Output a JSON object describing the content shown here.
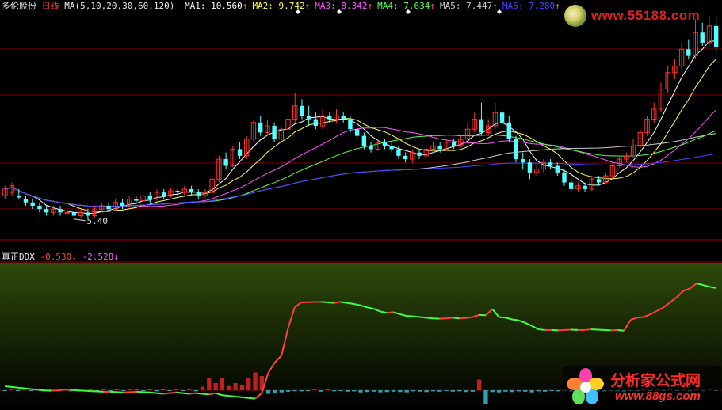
{
  "header": {
    "stock_name": "多伦股份",
    "period": "日线",
    "ma_spec": "MA(5,10,20,30,60,120)",
    "ma_values": [
      {
        "label": "MA1:",
        "value": "10.560",
        "arrow": "↑",
        "color": "#ffffff"
      },
      {
        "label": "MA2:",
        "value": "9.742",
        "arrow": "↑",
        "color": "#ffff55"
      },
      {
        "label": "MA3:",
        "value": "8.342",
        "arrow": "↑",
        "color": "#ff55ff"
      },
      {
        "label": "MA4:",
        "value": "7.634",
        "arrow": "↑",
        "color": "#55ff55"
      },
      {
        "label": "MA5:",
        "value": "7.447",
        "arrow": "↑",
        "color": "#cccccc"
      },
      {
        "label": "MA6:",
        "value": "7.280",
        "arrow": "↑",
        "color": "#4444ff"
      }
    ]
  },
  "ddx_header": {
    "name": "真正DDX",
    "value1": "-0.530",
    "arrow1": "↓",
    "value2": "-2.528",
    "arrow2": "↓"
  },
  "low_label": "5.40",
  "watermark_top": {
    "url": "www.55188.com"
  },
  "watermark_bottom": {
    "title": "分析家公式网",
    "url": "www.88gs.com"
  },
  "colors": {
    "up": "#ff3232",
    "down": "#54ffff",
    "ma1": "#ffffff",
    "ma2": "#ffff55",
    "ma3": "#ff55ff",
    "ma4": "#55ff55",
    "ma5": "#cccccc",
    "ma6": "#4444ff",
    "grid": "#800000",
    "ddx_up": "#ff4040",
    "ddx_down": "#40ff40"
  },
  "chart_data": [
    {
      "type": "candlestick",
      "title": "多伦股份 日线",
      "ylim": [
        4.8,
        11.6
      ],
      "lowest_marked": 5.4,
      "candles": [
        [
          6.1,
          6.3,
          6.4,
          6.0
        ],
        [
          6.2,
          6.4,
          6.5,
          6.1
        ],
        [
          6.1,
          6.05,
          6.3,
          6.0
        ],
        [
          6.0,
          5.9,
          6.1,
          5.8
        ],
        [
          5.9,
          5.8,
          6.0,
          5.7
        ],
        [
          5.8,
          5.7,
          5.9,
          5.6
        ],
        [
          5.7,
          5.6,
          5.8,
          5.5
        ],
        [
          5.6,
          5.7,
          5.8,
          5.5
        ],
        [
          5.7,
          5.6,
          5.8,
          5.5
        ],
        [
          5.6,
          5.6,
          5.7,
          5.5
        ],
        [
          5.6,
          5.5,
          5.7,
          5.4
        ],
        [
          5.5,
          5.6,
          5.7,
          5.45
        ],
        [
          5.6,
          5.5,
          5.7,
          5.4
        ],
        [
          5.5,
          5.7,
          5.8,
          5.45
        ],
        [
          5.7,
          5.8,
          5.9,
          5.6
        ],
        [
          5.8,
          5.7,
          5.9,
          5.65
        ],
        [
          5.7,
          5.9,
          6.0,
          5.65
        ],
        [
          5.9,
          5.8,
          6.0,
          5.7
        ],
        [
          5.8,
          6.0,
          6.1,
          5.75
        ],
        [
          6.0,
          5.95,
          6.1,
          5.85
        ],
        [
          5.95,
          6.1,
          6.2,
          5.9
        ],
        [
          6.1,
          6.0,
          6.2,
          5.9
        ],
        [
          6.0,
          6.2,
          6.3,
          5.95
        ],
        [
          6.2,
          6.1,
          6.3,
          6.0
        ],
        [
          6.1,
          6.25,
          6.35,
          6.05
        ],
        [
          6.25,
          6.2,
          6.3,
          6.1
        ],
        [
          6.2,
          6.3,
          6.4,
          6.1
        ],
        [
          6.3,
          6.2,
          6.4,
          6.1
        ],
        [
          6.2,
          6.1,
          6.3,
          6.0
        ],
        [
          6.1,
          6.2,
          6.3,
          6.05
        ],
        [
          6.2,
          6.6,
          6.7,
          6.15
        ],
        [
          6.6,
          7.2,
          7.3,
          6.5
        ],
        [
          7.2,
          7.0,
          7.4,
          6.9
        ],
        [
          7.0,
          7.5,
          7.6,
          6.95
        ],
        [
          7.5,
          7.3,
          7.7,
          7.2
        ],
        [
          7.3,
          7.8,
          7.9,
          7.2
        ],
        [
          7.8,
          8.3,
          8.4,
          7.7
        ],
        [
          8.3,
          8.0,
          8.5,
          7.9
        ],
        [
          8.0,
          8.2,
          8.4,
          7.9
        ],
        [
          8.2,
          7.8,
          8.3,
          7.7
        ],
        [
          7.8,
          8.1,
          8.2,
          7.7
        ],
        [
          8.1,
          8.4,
          8.6,
          8.0
        ],
        [
          8.4,
          8.8,
          9.2,
          8.3
        ],
        [
          8.8,
          8.5,
          9.0,
          8.4
        ],
        [
          8.5,
          8.4,
          8.8,
          8.2
        ],
        [
          8.4,
          8.2,
          8.6,
          8.1
        ],
        [
          8.2,
          8.5,
          8.7,
          8.1
        ],
        [
          8.5,
          8.4,
          8.6,
          8.3
        ],
        [
          8.4,
          8.5,
          8.7,
          8.3
        ],
        [
          8.5,
          8.4,
          8.6,
          8.3
        ],
        [
          8.4,
          8.1,
          8.5,
          8.0
        ],
        [
          8.1,
          7.9,
          8.2,
          7.8
        ],
        [
          7.9,
          7.6,
          8.0,
          7.5
        ],
        [
          7.6,
          7.5,
          7.7,
          7.4
        ],
        [
          7.5,
          7.7,
          7.8,
          7.45
        ],
        [
          7.7,
          7.6,
          7.8,
          7.5
        ],
        [
          7.6,
          7.5,
          7.7,
          7.4
        ],
        [
          7.5,
          7.3,
          7.6,
          7.2
        ],
        [
          7.3,
          7.2,
          7.4,
          7.1
        ],
        [
          7.2,
          7.4,
          7.5,
          7.1
        ],
        [
          7.4,
          7.3,
          7.5,
          7.2
        ],
        [
          7.3,
          7.5,
          7.6,
          7.25
        ],
        [
          7.5,
          7.6,
          7.7,
          7.4
        ],
        [
          7.6,
          7.5,
          7.7,
          7.4
        ],
        [
          7.5,
          7.7,
          7.8,
          7.45
        ],
        [
          7.7,
          7.6,
          7.8,
          7.5
        ],
        [
          7.6,
          7.8,
          7.9,
          7.55
        ],
        [
          7.8,
          8.1,
          8.3,
          7.75
        ],
        [
          8.1,
          8.4,
          8.6,
          8.0
        ],
        [
          8.4,
          8.0,
          8.9,
          7.9
        ],
        [
          8.0,
          8.2,
          8.4,
          7.9
        ],
        [
          8.2,
          8.6,
          8.9,
          8.1
        ],
        [
          8.6,
          8.3,
          8.7,
          8.2
        ],
        [
          8.3,
          7.8,
          8.5,
          7.7
        ],
        [
          7.8,
          7.2,
          7.9,
          7.1
        ],
        [
          7.2,
          7.1,
          7.4,
          6.9
        ],
        [
          7.1,
          6.8,
          7.2,
          6.6
        ],
        [
          6.8,
          6.9,
          7.0,
          6.7
        ],
        [
          6.9,
          7.1,
          7.2,
          6.8
        ],
        [
          7.1,
          7.0,
          7.2,
          6.9
        ],
        [
          7.0,
          6.8,
          7.1,
          6.7
        ],
        [
          6.8,
          6.5,
          6.9,
          6.4
        ],
        [
          6.5,
          6.3,
          6.6,
          6.2
        ],
        [
          6.3,
          6.4,
          6.5,
          6.2
        ],
        [
          6.4,
          6.3,
          6.5,
          6.2
        ],
        [
          6.3,
          6.6,
          6.7,
          6.25
        ],
        [
          6.6,
          6.5,
          6.7,
          6.4
        ],
        [
          6.5,
          6.7,
          6.8,
          6.45
        ],
        [
          6.7,
          7.0,
          7.1,
          6.65
        ],
        [
          7.0,
          7.2,
          7.3,
          6.95
        ],
        [
          7.2,
          7.3,
          7.4,
          7.1
        ],
        [
          7.3,
          7.6,
          7.8,
          7.25
        ],
        [
          7.6,
          8.0,
          8.1,
          7.55
        ],
        [
          8.0,
          8.4,
          8.5,
          7.9
        ],
        [
          8.4,
          8.7,
          8.9,
          8.3
        ],
        [
          8.7,
          9.3,
          9.5,
          8.6
        ],
        [
          9.3,
          9.8,
          10.0,
          9.2
        ],
        [
          9.8,
          10.0,
          10.2,
          9.6
        ],
        [
          10.0,
          10.5,
          10.7,
          9.9
        ],
        [
          10.5,
          10.3,
          10.8,
          10.2
        ],
        [
          10.3,
          11.0,
          11.4,
          10.2
        ],
        [
          11.0,
          10.7,
          11.3,
          10.6
        ],
        [
          10.7,
          11.2,
          11.5,
          10.6
        ],
        [
          11.2,
          10.56,
          11.5,
          10.4
        ]
      ],
      "moving_averages": [
        "MA1",
        "MA2",
        "MA3",
        "MA4",
        "MA5",
        "MA6"
      ]
    },
    {
      "type": "line",
      "title": "真正DDX",
      "ylim": [
        -3.0,
        1.2
      ],
      "series": [
        {
          "name": "DDX",
          "values": [
            -2.4,
            -2.42,
            -2.44,
            -2.46,
            -2.48,
            -2.5,
            -2.52,
            -2.53,
            -2.52,
            -2.5,
            -2.5,
            -2.52,
            -2.53,
            -2.54,
            -2.55,
            -2.56,
            -2.56,
            -2.57,
            -2.58,
            -2.57,
            -2.56,
            -2.57,
            -2.58,
            -2.6,
            -2.62,
            -2.6,
            -2.58,
            -2.6,
            -2.62,
            -2.6,
            -2.62,
            -2.64,
            -2.6,
            -2.66,
            -2.68,
            -2.7,
            -2.72,
            -2.74,
            -2.76,
            -2.6,
            -2.0,
            -1.7,
            -1.5,
            -0.7,
            -0.1,
            0.05,
            0.05,
            0.06,
            0.06,
            0.05,
            0.03,
            0.06,
            0.03,
            0.0,
            -0.04,
            -0.1,
            -0.14,
            -0.22,
            -0.26,
            -0.24,
            -0.3,
            -0.35,
            -0.36,
            -0.38,
            -0.4,
            -0.42,
            -0.43,
            -0.42,
            -0.4,
            -0.42,
            -0.41,
            -0.38,
            -0.32,
            -0.33,
            -0.15,
            -0.38,
            -0.4,
            -0.45,
            -0.48,
            -0.55,
            -0.64,
            -0.74,
            -0.76,
            -0.76,
            -0.77,
            -0.76,
            -0.75,
            -0.76,
            -0.76,
            -0.74,
            -0.75,
            -0.76,
            -0.77,
            -0.76,
            -0.78,
            -0.46,
            -0.4,
            -0.38,
            -0.3,
            -0.2,
            -0.1,
            0.05,
            0.2,
            0.38,
            0.45,
            0.6,
            0.55,
            0.5,
            0.46
          ]
        },
        {
          "name": "DDX_bar",
          "values": [
            -0.02,
            0.01,
            -0.02,
            0.02,
            -0.01,
            0.02,
            -0.03,
            0.02,
            -0.02,
            0.01,
            -0.03,
            0.02,
            -0.02,
            0.03,
            -0.01,
            0.02,
            -0.02,
            0.01,
            -0.02,
            0.02,
            0.01,
            -0.02,
            0.02,
            -0.03,
            0.02,
            -0.01,
            0.02,
            -0.02,
            0.02,
            -0.03,
            0.1,
            0.35,
            0.2,
            0.35,
            0.12,
            0.2,
            0.15,
            0.35,
            0.5,
            0.4,
            -0.1,
            -0.08,
            -0.06,
            -0.04,
            -0.02,
            -0.03,
            -0.02,
            0.02,
            -0.04,
            0.02,
            -0.03,
            -0.02,
            -0.04,
            -0.03,
            -0.06,
            -0.05,
            -0.04,
            -0.06,
            -0.05,
            -0.04,
            -0.05,
            -0.06,
            -0.03,
            -0.04,
            -0.05,
            -0.03,
            -0.04,
            -0.02,
            -0.04,
            -0.03,
            -0.05,
            -0.04,
            0.3,
            -0.4,
            -0.05,
            -0.06,
            -0.04,
            -0.05,
            -0.03,
            -0.04,
            -0.06,
            -0.03,
            -0.04,
            -0.02,
            -0.03,
            -0.02,
            -0.04,
            -0.03,
            -0.05,
            -0.02,
            -0.03,
            -0.04,
            -0.02,
            -0.03,
            -0.05,
            -0.02,
            -0.03,
            0.02,
            -0.02,
            0.02,
            -0.02,
            0.03,
            -0.02,
            0.02,
            -0.03,
            0.02,
            -0.02,
            0.02,
            -0.02
          ]
        }
      ]
    }
  ]
}
